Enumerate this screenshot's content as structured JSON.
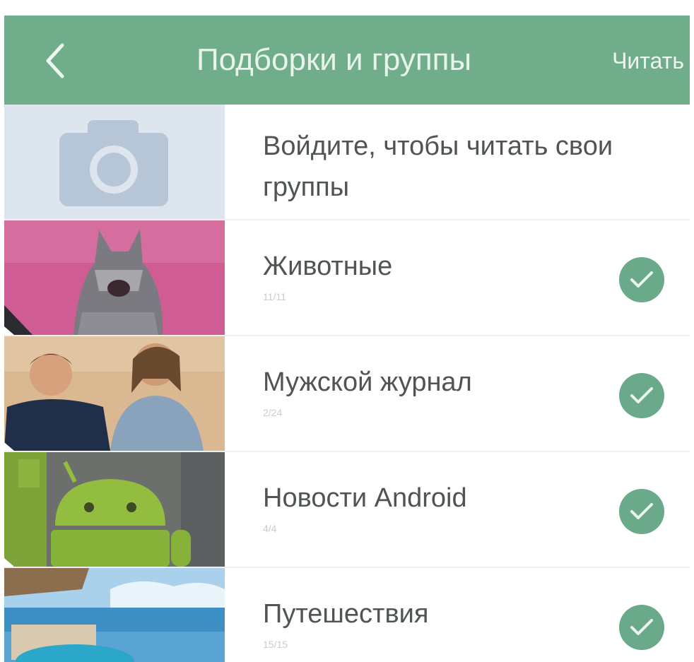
{
  "header": {
    "title": "Подборки и группы",
    "read_label": "Читать"
  },
  "login_row": {
    "text": "Войдите, чтобы читать свои группы"
  },
  "rows": [
    {
      "label": "Животные",
      "count": "11/11",
      "checked": true
    },
    {
      "label": "Мужской журнал",
      "count": "2/24",
      "checked": true
    },
    {
      "label": "Новости Android",
      "count": "4/4",
      "checked": true
    },
    {
      "label": "Путешествия",
      "count": "15/15",
      "checked": true
    }
  ],
  "colors": {
    "header_bg": "#6fad8b",
    "check_bg": "#6aa98a",
    "camera_bg": "#dde6ef",
    "camera_icon": "#b7c6d6"
  }
}
